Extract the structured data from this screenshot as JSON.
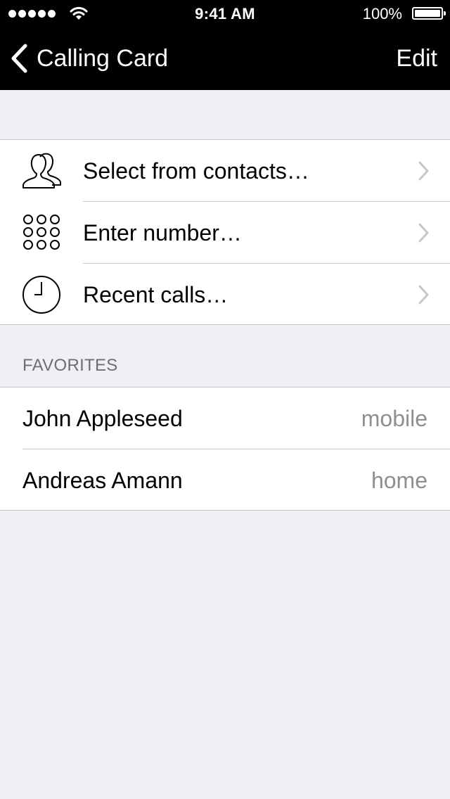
{
  "status_bar": {
    "time": "9:41 AM",
    "battery_percent": "100%",
    "signal_icon": "signal-dots-icon",
    "wifi_icon": "wifi-icon",
    "battery_icon": "battery-icon"
  },
  "nav": {
    "back_label": "Calling Card",
    "back_icon": "chevron-left-icon",
    "edit_label": "Edit"
  },
  "actions": [
    {
      "label": "Select from contacts…",
      "icon": "contacts-icon"
    },
    {
      "label": "Enter number…",
      "icon": "keypad-icon"
    },
    {
      "label": "Recent calls…",
      "icon": "clock-icon"
    }
  ],
  "favorites": {
    "header": "FAVORITES",
    "items": [
      {
        "name": "John Appleseed",
        "type": "mobile"
      },
      {
        "name": "Andreas Amann",
        "type": "home"
      }
    ]
  },
  "colors": {
    "nav_background": "#000000",
    "page_background": "#efeff4",
    "separator": "#c8c7cc",
    "secondary_text": "#8e8e93",
    "chevron": "#c7c7cc"
  }
}
